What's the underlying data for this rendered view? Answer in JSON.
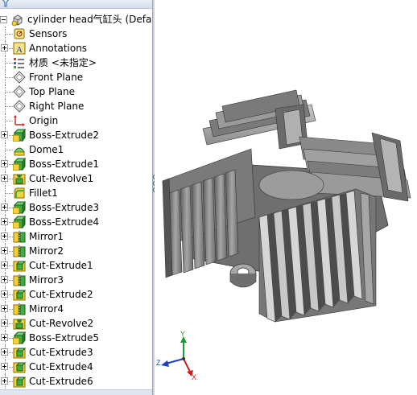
{
  "tree": {
    "root_label": "cylinder head气缸头  (Defa",
    "items": [
      {
        "label": "Sensors",
        "icon": "sensors-icon",
        "expandable": false
      },
      {
        "label": "Annotations",
        "icon": "annotations-icon",
        "expandable": true
      },
      {
        "label": "材质 <未指定>",
        "icon": "material-icon",
        "expandable": false
      },
      {
        "label": "Front Plane",
        "icon": "plane-icon",
        "expandable": false
      },
      {
        "label": "Top Plane",
        "icon": "plane-icon",
        "expandable": false
      },
      {
        "label": "Right Plane",
        "icon": "plane-icon",
        "expandable": false
      },
      {
        "label": "Origin",
        "icon": "origin-icon",
        "expandable": false
      },
      {
        "label": "Boss-Extrude2",
        "icon": "boss-extrude-icon",
        "expandable": true
      },
      {
        "label": "Dome1",
        "icon": "dome-icon",
        "expandable": false
      },
      {
        "label": "Boss-Extrude1",
        "icon": "boss-extrude-icon",
        "expandable": true
      },
      {
        "label": "Cut-Revolve1",
        "icon": "cut-revolve-icon",
        "expandable": true
      },
      {
        "label": "Fillet1",
        "icon": "fillet-icon",
        "expandable": false
      },
      {
        "label": "Boss-Extrude3",
        "icon": "boss-extrude-icon",
        "expandable": true
      },
      {
        "label": "Boss-Extrude4",
        "icon": "boss-extrude-icon",
        "expandable": true
      },
      {
        "label": "Mirror1",
        "icon": "mirror-icon",
        "expandable": true
      },
      {
        "label": "Mirror2",
        "icon": "mirror-icon",
        "expandable": true
      },
      {
        "label": "Cut-Extrude1",
        "icon": "cut-extrude-icon",
        "expandable": true
      },
      {
        "label": "Mirror3",
        "icon": "mirror-icon",
        "expandable": true
      },
      {
        "label": "Cut-Extrude2",
        "icon": "cut-extrude-icon",
        "expandable": true
      },
      {
        "label": "Mirror4",
        "icon": "mirror-icon",
        "expandable": true
      },
      {
        "label": "Cut-Revolve2",
        "icon": "cut-revolve-icon",
        "expandable": true
      },
      {
        "label": "Boss-Extrude5",
        "icon": "boss-extrude-icon",
        "expandable": true
      },
      {
        "label": "Cut-Extrude3",
        "icon": "cut-extrude-icon",
        "expandable": true
      },
      {
        "label": "Cut-Extrude4",
        "icon": "cut-extrude-icon",
        "expandable": true
      },
      {
        "label": "Cut-Extrude6",
        "icon": "cut-extrude-icon",
        "expandable": true
      }
    ]
  },
  "triad": {
    "x_label": "X",
    "y_label": "Y",
    "z_label": "Z"
  },
  "colors": {
    "tree_bg": "#ffffff",
    "feature_yellow": "#f2d33a",
    "feature_green": "#3fae3f",
    "model_gray": "#8f8f8f",
    "axis_x": "#c81e1e",
    "axis_y": "#1e9a3a",
    "axis_z": "#1e3ec8"
  }
}
